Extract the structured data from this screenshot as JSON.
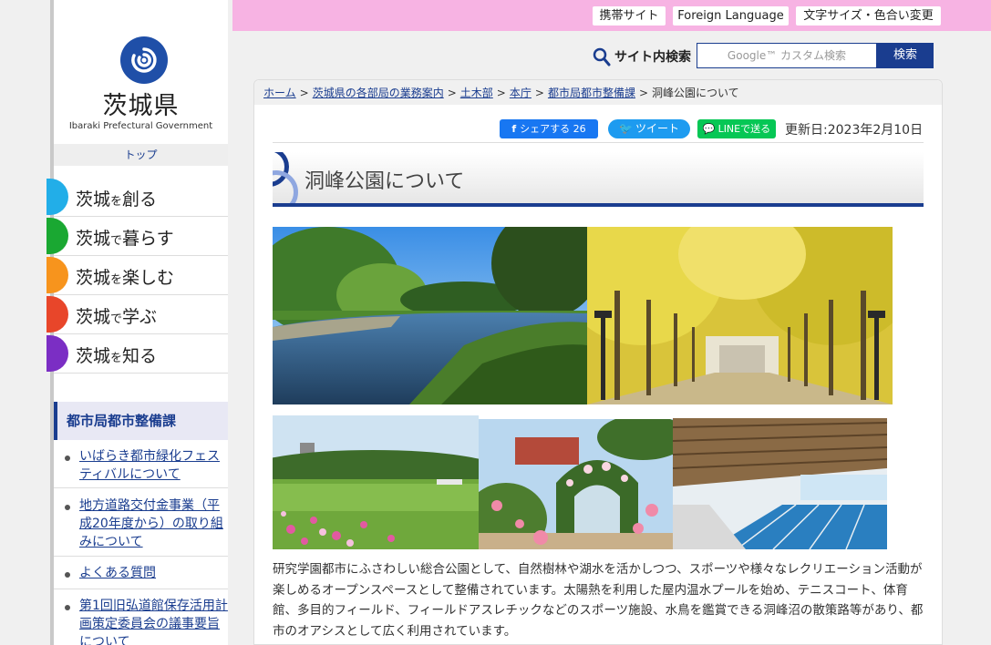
{
  "header": {
    "links": [
      "携帯サイト",
      "Foreign Language",
      "文字サイズ・色合い変更"
    ]
  },
  "logo": {
    "title": "茨城県",
    "subtitle": "Ibaraki Prefectural Government"
  },
  "sidebar": {
    "top_label": "トップ",
    "nav": [
      {
        "a": "茨城",
        "p": "を",
        "b": "創る",
        "color": "#22aee8"
      },
      {
        "a": "茨城",
        "p": "で",
        "b": "暮らす",
        "color": "#1aa832"
      },
      {
        "a": "茨城",
        "p": "を",
        "b": "楽しむ",
        "color": "#f7941d"
      },
      {
        "a": "茨城",
        "p": "で",
        "b": "学ぶ",
        "color": "#e8462a"
      },
      {
        "a": "茨城",
        "p": "を",
        "b": "知る",
        "color": "#7b2ec4"
      }
    ],
    "section_title": "都市局都市整備課",
    "section_links": [
      "いばらき都市緑化フェスティバルについて",
      "地方道路交付金事業（平成20年度から）の取り組みについて",
      "よくある質問",
      "第1回旧弘道館保存活用計画策定委員会の議事要旨について"
    ]
  },
  "search": {
    "label": "サイト内検索",
    "placeholder": "Google™ カスタム検索",
    "button": "検索"
  },
  "breadcrumb": {
    "items": [
      "ホーム",
      "茨城県の各部局の業務案内",
      "土木部",
      "本庁",
      "都市局都市整備課"
    ],
    "current": "洞峰公園について"
  },
  "share": {
    "facebook": "シェアする 26",
    "twitter": "ツイート",
    "line": "LINEで送る"
  },
  "updated": "更新日:2023年2月10日",
  "page_title": "洞峰公園について",
  "body_text": "研究学園都市にふさわしい総合公園として、自然樹林や湖水を活かしつつ、スポーツや様々なレクリエーション活動が楽しめるオープンスペースとして整備されています。太陽熱を利用した屋内温水プールを始め、テニスコート、体育館、多目的フィールド、フィールドアスレチックなどのスポーツ施設、水鳥を鑑賞できる洞峰沼の散策路等があり、都市のオアシスとして広く利用されています。",
  "colors": {
    "brand": "#1a3d8f",
    "topbar": "#f7b3e3"
  }
}
